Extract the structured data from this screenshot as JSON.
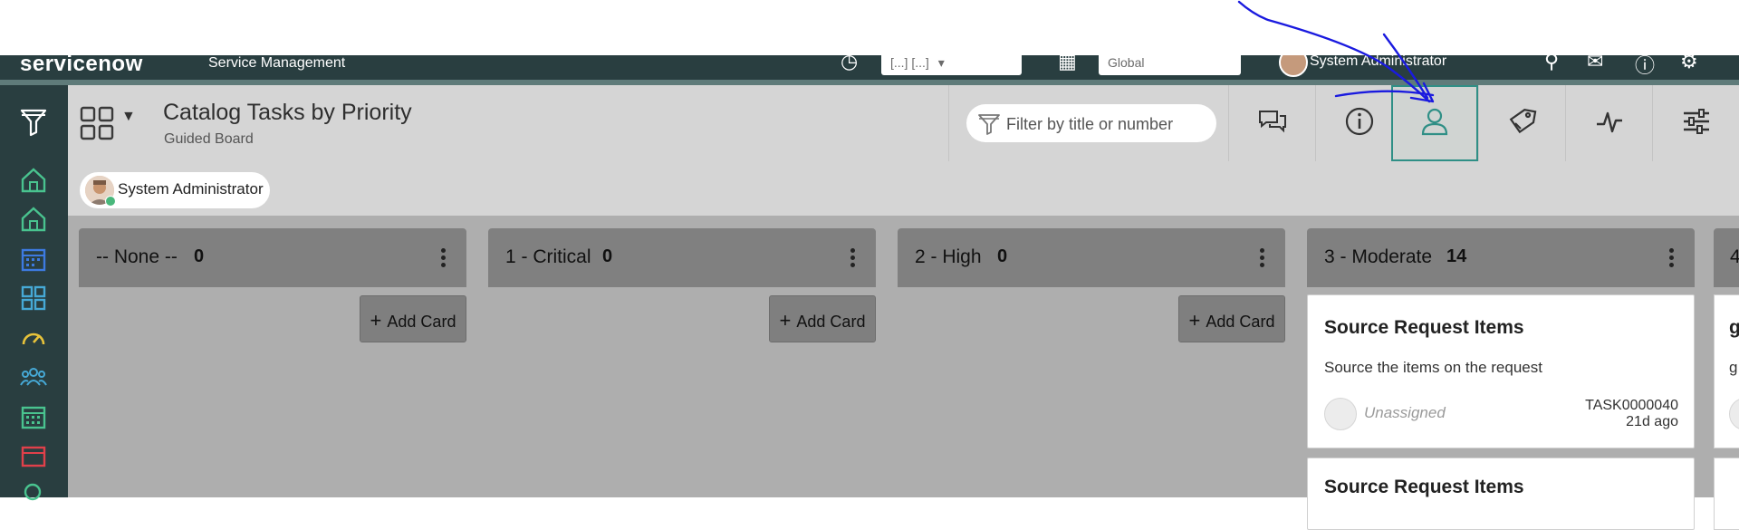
{
  "header": {
    "brand": "servicenow",
    "product": "Service Management",
    "scope_pill": "[...] [...]",
    "scope_pill_suffix": "▾",
    "app_pill": "Global",
    "user_name": "System Administrator"
  },
  "board": {
    "title": "Catalog Tasks by Priority",
    "subtitle": "Guided Board",
    "filter_placeholder": "Filter by title or number",
    "user_chip": "System Administrator"
  },
  "lanes": [
    {
      "name": "-- None --",
      "count": "0",
      "add_label": "Add Card"
    },
    {
      "name": "1 - Critical",
      "count": "0",
      "add_label": "Add Card"
    },
    {
      "name": "2 - High",
      "count": "0",
      "add_label": "Add Card"
    },
    {
      "name": "3 - Moderate",
      "count": "14"
    },
    {
      "name": "4",
      "count": ""
    }
  ],
  "cards": [
    {
      "title": "Source Request Items",
      "description": "Source the items on the request",
      "assignee": "Unassigned",
      "number": "TASK0000040",
      "age": "21d ago"
    },
    {
      "title": "Source Request Items"
    }
  ],
  "lane5_preview": {
    "title_fragment": "g",
    "desc_fragment": "g"
  },
  "colors": {
    "header_bg": "#293e40",
    "accent": "#2f8f86",
    "lane_head": "#808080",
    "board_bg": "#aeaeae",
    "annotation_arrow": "#1a1adf"
  },
  "icons": {
    "leftnav": [
      "filter-icon",
      "home-icon",
      "home-icon",
      "calendar-icon",
      "grid-icon",
      "gauge-icon",
      "people-icon",
      "calendar-icon",
      "calendar-icon",
      "search-icon"
    ],
    "toolbar": [
      "chat-icon",
      "info-icon",
      "user-icon",
      "tag-icon",
      "activity-icon",
      "sliders-icon"
    ]
  }
}
